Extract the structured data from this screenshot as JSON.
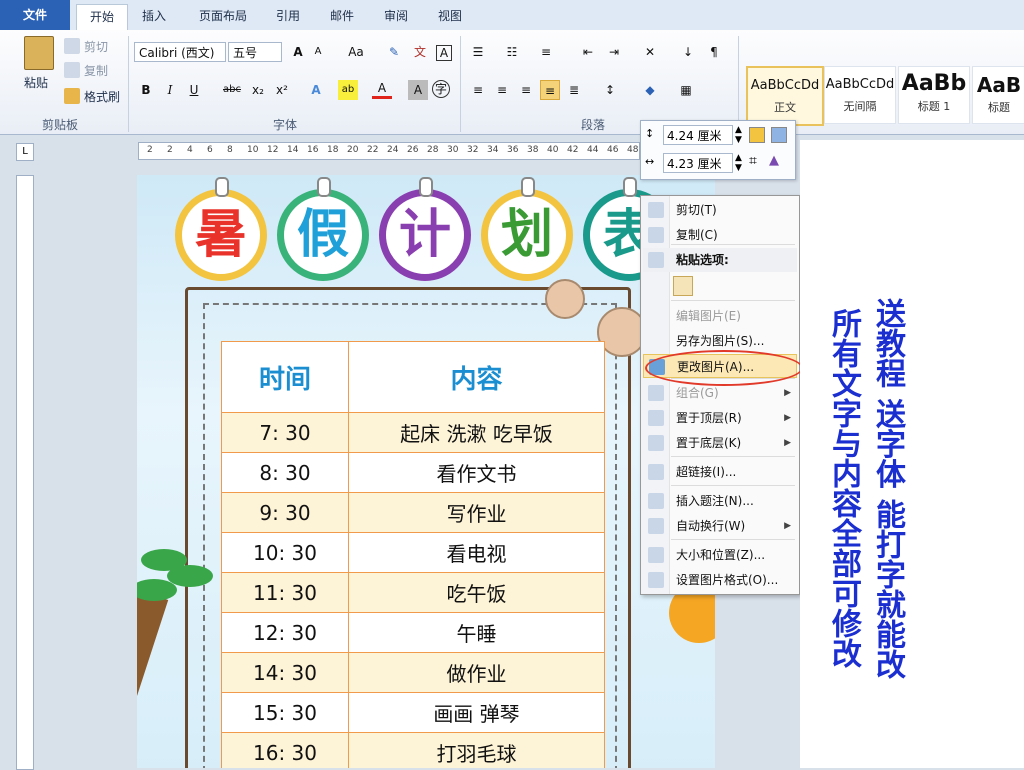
{
  "ribbon": {
    "tabs": [
      "文件",
      "开始",
      "插入",
      "页面布局",
      "引用",
      "邮件",
      "审阅",
      "视图"
    ],
    "clipboard": {
      "paste": "粘贴",
      "cut": "剪切",
      "copy": "复制",
      "format_painter": "格式刷",
      "label": "剪贴板"
    },
    "font": {
      "name": "Calibri (西文)",
      "size": "五号",
      "label": "字体",
      "buttons": [
        "B",
        "I",
        "U",
        "abc",
        "x₂",
        "x²"
      ]
    },
    "paragraph": {
      "label": "段落"
    },
    "styles": [
      {
        "sample": "AaBbCcDd",
        "name": "正文"
      },
      {
        "sample": "AaBbCcDd",
        "name": "无间隔"
      },
      {
        "sample": "AaBb",
        "name": "标题 1"
      },
      {
        "sample": "AaB",
        "name": "标题"
      }
    ]
  },
  "ruler": {
    "numbers": [
      "2",
      "2",
      "4",
      "6",
      "8",
      "10",
      "12",
      "14",
      "16",
      "18",
      "20",
      "22",
      "24",
      "26",
      "28",
      "30",
      "32",
      "34",
      "36",
      "38",
      "40",
      "42",
      "44",
      "46",
      "48"
    ]
  },
  "document": {
    "title_chars": [
      "暑",
      "假",
      "计",
      "划",
      "表"
    ],
    "title_colors": [
      "#e8322a",
      "#1fa0d8",
      "#8a3fb0",
      "#3a9b34",
      "#1a9a8a"
    ],
    "table": {
      "headers": [
        "时间",
        "内容"
      ],
      "rows": [
        [
          "7: 30",
          "起床  洗漱  吃早饭"
        ],
        [
          "8: 30",
          "看作文书"
        ],
        [
          "9: 30",
          "写作业"
        ],
        [
          "10: 30",
          "看电视"
        ],
        [
          "11: 30",
          "吃午饭"
        ],
        [
          "12: 30",
          "午睡"
        ],
        [
          "14: 30",
          "做作业"
        ],
        [
          "15: 30",
          "画画  弹琴"
        ],
        [
          "16: 30",
          "打羽毛球"
        ]
      ]
    }
  },
  "size_toolbar": {
    "height": "4.24 厘米",
    "width": "4.23 厘米"
  },
  "context_menu": {
    "items": [
      {
        "label": "剪切(T)",
        "icon": "scissors-icon"
      },
      {
        "label": "复制(C)",
        "icon": "copy-icon"
      },
      {
        "label": "粘贴选项:",
        "icon": "paste-icon",
        "header": true
      },
      {
        "label": "编辑图片(E)",
        "disabled": true
      },
      {
        "label": "另存为图片(S)..."
      },
      {
        "label": "更改图片(A)...",
        "icon": "change-picture-icon",
        "highlight": true
      },
      {
        "label": "组合(G)",
        "icon": "group-icon",
        "disabled": true,
        "submenu": true
      },
      {
        "label": "置于顶层(R)",
        "icon": "bring-front-icon",
        "submenu": true
      },
      {
        "label": "置于底层(K)",
        "icon": "send-back-icon",
        "submenu": true
      },
      {
        "label": "超链接(I)...",
        "icon": "hyperlink-icon"
      },
      {
        "label": "插入题注(N)...",
        "icon": "caption-icon"
      },
      {
        "label": "自动换行(W)",
        "icon": "wrap-icon",
        "submenu": true
      },
      {
        "label": "大小和位置(Z)...",
        "icon": "size-position-icon"
      },
      {
        "label": "设置图片格式(O)...",
        "icon": "format-picture-icon"
      }
    ]
  },
  "promo": {
    "line1": "送教程 送字体 能打字就能改",
    "line2": "所有文字与内容全部可修改"
  },
  "colors": {
    "accent": "#2b62b5",
    "promo": "#1b2fd0",
    "highlight_oval": "#e23a2a",
    "header_text": "#1a8ed0"
  }
}
